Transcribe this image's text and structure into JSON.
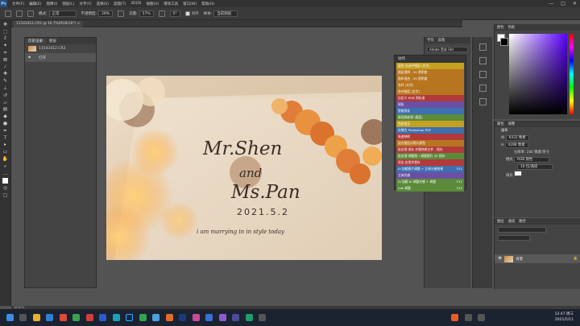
{
  "menubar": {
    "logo": "Ps",
    "items": [
      "文件(F)",
      "编辑(E)",
      "图像(I)",
      "图层(L)",
      "文字(Y)",
      "选择(S)",
      "滤镜(T)",
      "3D(D)",
      "视图(V)",
      "增效工具",
      "窗口(W)",
      "帮助(H)"
    ],
    "window_controls": [
      "—",
      "□",
      "✕"
    ]
  },
  "options": {
    "mode_label": "模式:",
    "mode_value": "正常",
    "opacity_label": "不透明度:",
    "opacity_value": "29%",
    "flow_label": "流量:",
    "flow_value": "57%",
    "angle_value": "0°",
    "smooth_label": "对齐",
    "sample_label": "样本:",
    "sample_value": "当前图层"
  },
  "document": {
    "tab_label": "11543412.CR2 @ 16.7%(RGB/16*) ×",
    "zoom": "16.67%"
  },
  "history": {
    "tabs": [
      "历史记录",
      "图层"
    ],
    "rows": [
      "11543412.CR2",
      "打开"
    ]
  },
  "photo": {
    "line1": "Mr.Shen",
    "line2": "and",
    "line3": "Ms.Pan",
    "date": "2021.5.2",
    "tagline": "i am marrying in in style today"
  },
  "midpanel": {
    "tabs": [
      "字符",
      "段落"
    ],
    "font": "Adobe 黑体 Std",
    "percent": "100%"
  },
  "actions": {
    "title": "动作",
    "items": [
      {
        "label": "混合-先选中图层 (名字)",
        "color": "#c4a11e",
        "key": ""
      },
      {
        "label": "图层透明 - 50 透明度",
        "color": "#b8751f",
        "key": ""
      },
      {
        "label": "画布混合 - 50 透明度",
        "color": "#b8751f",
        "key": ""
      },
      {
        "label": "合并 (文字)",
        "color": "#b8751f",
        "key": ""
      },
      {
        "label": "合并图层 (文字)",
        "color": "#b8751f",
        "key": ""
      },
      {
        "label": "自定义 RGB 到标准",
        "color": "#b23a3a",
        "key": ""
      },
      {
        "label": "锐化",
        "color": "#6b4fa3",
        "key": ""
      },
      {
        "label": "智能锐化",
        "color": "#3e6fb0",
        "key": ""
      },
      {
        "label": "高低频处理 (图层)",
        "color": "#5b8a3a",
        "key": ""
      },
      {
        "label": "色彩校正",
        "color": "#c4a11e",
        "key": ""
      },
      {
        "label": "存储为 Photoshop PDF",
        "color": "#3e6fb0",
        "key": ""
      },
      {
        "label": "渐变映射",
        "color": "#b23a3a",
        "key": ""
      },
      {
        "label": "混合图层对照与颜色",
        "color": "#b8751f",
        "key": ""
      },
      {
        "label": "批处理 保存 并删除原文件 - 保存",
        "color": "#b23a3a",
        "key": ""
      },
      {
        "label": "批处理 调整图 +调整图片 00 保存",
        "color": "#5b8a3a",
        "key": ""
      },
      {
        "label": "导出 应用并保存",
        "color": "#b23a3a",
        "key": ""
      },
      {
        "label": "AI 加粗图片调整 + 立体光感效果",
        "color": "#3e6fb0",
        "key": "F11"
      },
      {
        "label": "立体光感",
        "color": "#6b4fa3",
        "key": ""
      },
      {
        "label": "AI 加粗 AI 调整光感 + 调整",
        "color": "#5b8a3a",
        "key": "F11"
      },
      {
        "label": "raw 调整",
        "color": "#5b8a3a",
        "key": "F10"
      }
    ]
  },
  "colorpanel": {
    "tabs": [
      "颜色",
      "色板"
    ]
  },
  "properties": {
    "tabs": [
      "属性",
      "调整"
    ],
    "section": "画布",
    "width_label": "W",
    "width_value": "6432 像素",
    "height_label": "H",
    "height_value": "4288 像素",
    "resolution_label": "分辨率:",
    "resolution_value": "240 像素/英寸",
    "mode_label": "模式",
    "mode_value": "RGB 颜色",
    "depth_value": "16 位/通道",
    "fill_label": "填充"
  },
  "layers": {
    "tabs": [
      "图层",
      "通道",
      "路径"
    ],
    "layer_name": "背景"
  },
  "statusbar": {
    "zoom": "16.67%"
  },
  "taskbar": {
    "time": "12:47 周三",
    "date": "2021/5/11"
  }
}
